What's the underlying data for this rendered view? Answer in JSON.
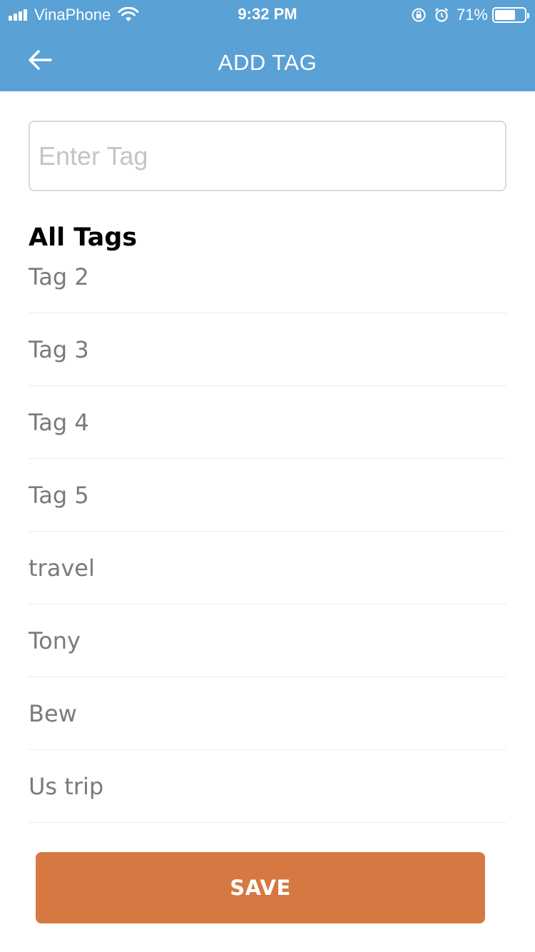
{
  "status_bar": {
    "carrier": "VinaPhone",
    "time": "9:32 PM",
    "battery_percent_label": "71%",
    "battery_level": 0.71,
    "icons": [
      "signal-icon",
      "wifi-icon",
      "rotation-lock-icon",
      "alarm-icon",
      "battery-icon"
    ]
  },
  "nav": {
    "title": "ADD TAG",
    "back_icon": "arrow-left-icon"
  },
  "tag_input": {
    "value": "",
    "placeholder": "Enter Tag"
  },
  "tags_section": {
    "title": "All Tags",
    "items": [
      {
        "label": "Tag 2"
      },
      {
        "label": "Tag 3"
      },
      {
        "label": "Tag 4"
      },
      {
        "label": "Tag 5"
      },
      {
        "label": "travel"
      },
      {
        "label": "Tony"
      },
      {
        "label": "Bew"
      },
      {
        "label": "Us trip"
      }
    ]
  },
  "save_button": {
    "label": "SAVE"
  },
  "colors": {
    "header": "#5aa1d6",
    "save_button": "#d67841",
    "tag_text": "#7a7a7a",
    "placeholder": "#c4c4c4",
    "divider": "#ececec"
  }
}
